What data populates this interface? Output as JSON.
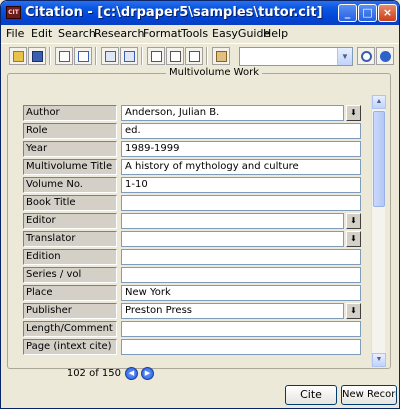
{
  "window": {
    "title": "Citation - [c:\\drpaper5\\samples\\tutor.cit]",
    "app_icon_text": "CIT"
  },
  "title_buttons": {
    "minimize": "_",
    "maximize": "□",
    "close": "×"
  },
  "menu": [
    "File",
    "Edit",
    "Search",
    "Research",
    "Format",
    "Tools",
    "EasyGuide",
    "Help"
  ],
  "toolbar": {
    "icons": [
      "open-folder-icon",
      "save-icon",
      "new-record-icon",
      "copy-record-icon",
      "list-view-icon",
      "form-view-icon",
      "print-icon",
      "export-icon",
      "clipboard-icon",
      "search-icon",
      "help-icon"
    ],
    "combo_value": ""
  },
  "panel": {
    "title": "Multivolume Work"
  },
  "fields": [
    {
      "label": "Author",
      "value": "Anderson, Julian B.",
      "dropdown": true
    },
    {
      "label": "Role",
      "value": "ed.",
      "dropdown": false
    },
    {
      "label": "Year",
      "value": "1989-1999",
      "dropdown": false
    },
    {
      "label": "Multivolume Title",
      "value": "A history of mythology and culture",
      "dropdown": false
    },
    {
      "label": "Volume No.",
      "value": "1-10",
      "dropdown": false
    },
    {
      "label": "Book Title",
      "value": "",
      "dropdown": false
    },
    {
      "label": "Editor",
      "value": "",
      "dropdown": true
    },
    {
      "label": "Translator",
      "value": "",
      "dropdown": true
    },
    {
      "label": "Edition",
      "value": "",
      "dropdown": false
    },
    {
      "label": "Series / vol",
      "value": "",
      "dropdown": false
    },
    {
      "label": "Place",
      "value": "New York",
      "dropdown": false
    },
    {
      "label": "Publisher",
      "value": "Preston Press",
      "dropdown": true
    },
    {
      "label": "Length/Comment",
      "value": "",
      "dropdown": false
    },
    {
      "label": "Page (intext cite)",
      "value": "",
      "dropdown": false
    }
  ],
  "navigation": {
    "counter": "102 of 150"
  },
  "buttons": {
    "cite": "Cite",
    "new_record": "New Record"
  },
  "colors": {
    "titlebar": "#0046d8",
    "field_border": "#7f9db9",
    "label_bg": "#d4d0c8"
  }
}
